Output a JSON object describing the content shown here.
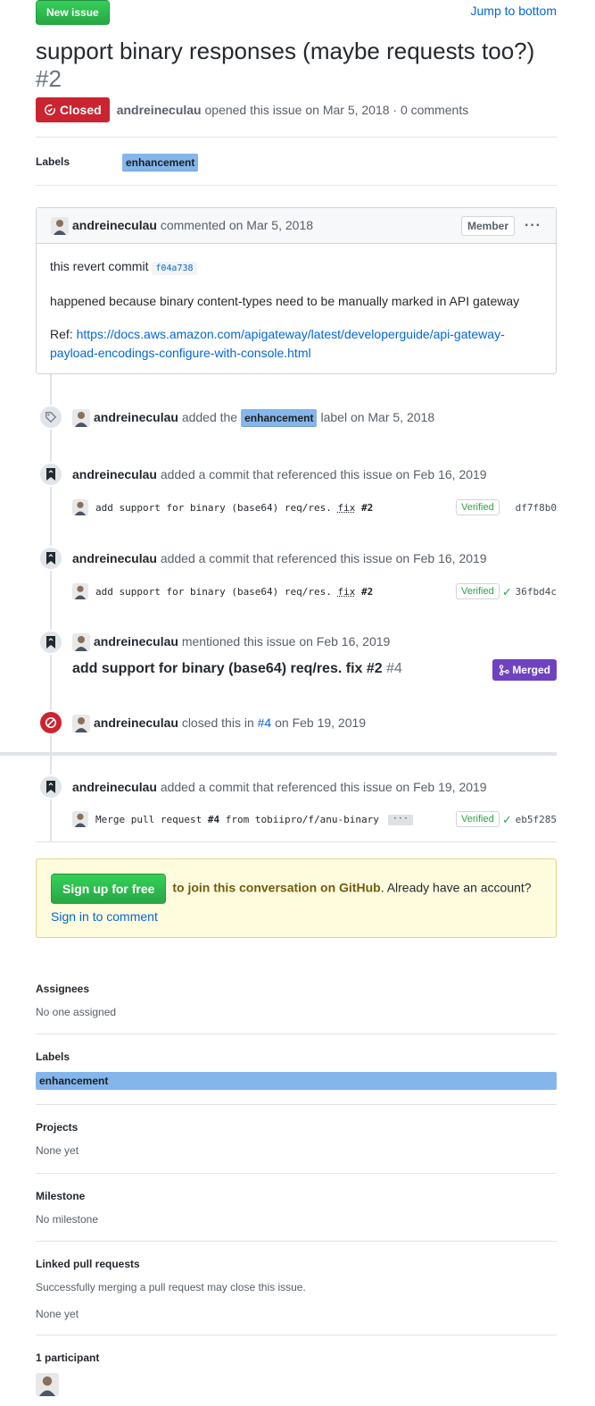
{
  "header": {
    "new_issue_label": "New issue",
    "jump_label": "Jump to bottom"
  },
  "issue": {
    "title": "support binary responses (maybe requests too?)",
    "number": "#2",
    "state": "Closed",
    "author": "andreineculau",
    "opened_text": "opened this issue on Mar 5, 2018 · 0 comments"
  },
  "labels_section": {
    "title": "Labels",
    "label": "enhancement",
    "label_color": "#84b6eb"
  },
  "comment": {
    "author": "andreineculau",
    "action": "commented on Mar 5, 2018",
    "role": "Member",
    "menu_glyph": "···",
    "line1_prefix": "this revert commit",
    "commit_sha": "f04a738",
    "line2": "happened because binary content-types need to be manually marked in API gateway",
    "ref_prefix": "Ref:",
    "ref_link": "https://docs.aws.amazon.com/apigateway/latest/developerguide/api-gateway-payload-encodings-configure-with-console.html"
  },
  "timeline": {
    "label_event": {
      "author": "andreineculau",
      "pre": "added the",
      "label": "enhancement",
      "post": "label on Mar 5, 2018"
    },
    "commit_event_1": {
      "author": "andreineculau",
      "text": "added a commit that referenced this issue on Feb 16, 2019",
      "msg_pre": "add support for binary (base64) req/res.",
      "msg_fix": "fix",
      "msg_ref": "#2",
      "verified": "Verified",
      "sha": "df7f8b0"
    },
    "commit_event_2": {
      "author": "andreineculau",
      "text": "added a commit that referenced this issue on Feb 16, 2019",
      "msg_pre": "add support for binary (base64) req/res.",
      "msg_fix": "fix",
      "msg_ref": "#2",
      "verified": "Verified",
      "sha": "36fbd4c"
    },
    "mention_event": {
      "author": "andreineculau",
      "text": "mentioned this issue on Feb 16, 2019",
      "pr_title": "add support for binary (base64) req/res. fix #2",
      "pr_number": "#4",
      "pr_state": "Merged"
    },
    "close_event": {
      "author": "andreineculau",
      "pre": "closed this in",
      "ref": "#4",
      "post": "on Feb 19, 2019"
    },
    "commit_event_3": {
      "author": "andreineculau",
      "text": "added a commit that referenced this issue on Feb 19, 2019",
      "msg_pre": "Merge pull request",
      "msg_ref": "#4",
      "msg_post": "from tobiipro/f/anu-binary",
      "ellipsis": "···",
      "verified": "Verified",
      "sha": "eb5f285"
    }
  },
  "signup": {
    "button": "Sign up for free",
    "strong_text": "to join this conversation on GitHub",
    "after": ". Already have an account?",
    "signin_link": "Sign in to comment"
  },
  "sidebar": {
    "assignees_title": "Assignees",
    "assignees_value": "No one assigned",
    "labels_title": "Labels",
    "labels_value": "enhancement",
    "projects_title": "Projects",
    "projects_value": "None yet",
    "milestone_title": "Milestone",
    "milestone_value": "No milestone",
    "linked_title": "Linked pull requests",
    "linked_desc": "Successfully merging a pull request may close this issue.",
    "linked_value": "None yet",
    "participants_title": "1 participant"
  },
  "icons": {
    "closed": "issue-closed-icon",
    "tag": "tag-icon",
    "bookmark": "bookmark-icon",
    "blocked": "circle-slash-icon",
    "merge": "git-merge-icon",
    "check": "check-icon",
    "kebab": "kebab-horizontal-icon"
  },
  "colors": {
    "closed_red": "#cb2431",
    "merged_purple": "#6f42c1",
    "green_button": "#2ea44f",
    "link_blue": "#0366d6",
    "label_blue": "#84b6eb"
  }
}
